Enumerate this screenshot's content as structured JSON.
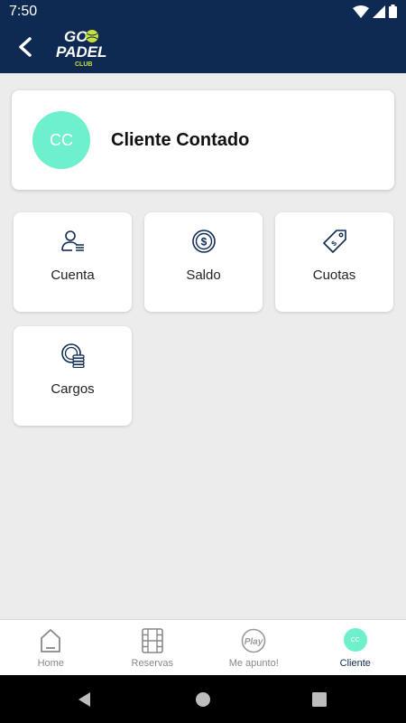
{
  "status_bar": {
    "time": "7:50"
  },
  "header": {
    "logo_text_top": "GO",
    "logo_text_mid": "PADEL",
    "logo_text_bottom": "CLUB"
  },
  "profile": {
    "initials": "CC",
    "name": "Cliente Contado"
  },
  "menu": {
    "cuenta": "Cuenta",
    "saldo": "Saldo",
    "cuotas": "Cuotas",
    "cargos": "Cargos"
  },
  "tabs": {
    "home": "Home",
    "reservas": "Reservas",
    "me_apunto": "Me apunto!",
    "cliente": "Cliente",
    "cliente_initials": "CC",
    "play_text": "Play"
  },
  "colors": {
    "header_bg": "#0e2a52",
    "accent": "#6ff0cc",
    "background": "#ececec"
  },
  "icons": [
    "back-arrow-icon",
    "user-list-icon",
    "coin-dollar-icon",
    "price-tag-icon",
    "coins-stack-icon",
    "home-icon",
    "film-court-icon",
    "play-icon"
  ]
}
